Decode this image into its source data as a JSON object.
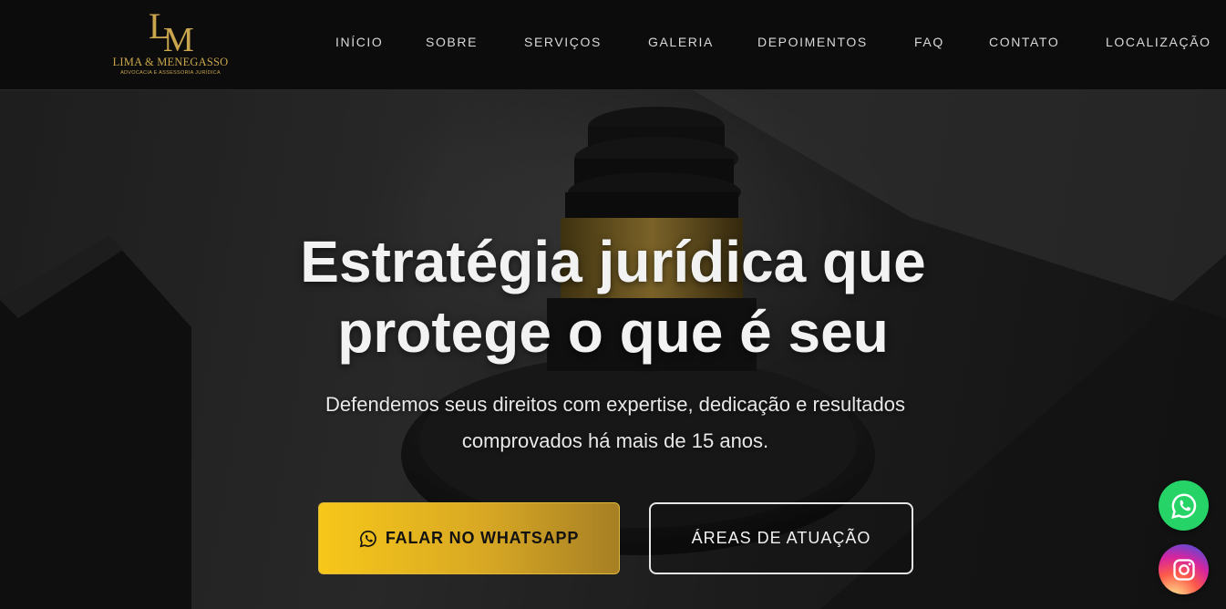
{
  "brand": {
    "monogram": "LM",
    "name": "LIMA & MENEGASSO",
    "tagline": "ADVOCACIA E ASSESSORIA JURÍDICA",
    "gold": "#c9a64e"
  },
  "nav": {
    "items": [
      {
        "label": "INÍCIO"
      },
      {
        "label": "SOBRE"
      },
      {
        "label": "SERVIÇOS"
      },
      {
        "label": "GALERIA"
      },
      {
        "label": "DEPOIMENTOS"
      },
      {
        "label": "FAQ"
      },
      {
        "label": "CONTATO"
      },
      {
        "label": "LOCALIZAÇÃO"
      }
    ]
  },
  "hero": {
    "headline_line1": "Estratégia jurídica que",
    "headline_line2": "protege o que é seu",
    "subtitle_line1": "Defendemos seus direitos com expertise, dedicação e resultados",
    "subtitle_line2": "comprovados há mais de 15 anos.",
    "cta_primary": {
      "label": "FALAR NO WHATSAPP",
      "icon": "whatsapp-icon"
    },
    "cta_secondary": {
      "label": "ÁREAS DE ATUAÇÃO"
    },
    "background_image": "judge-gavel"
  },
  "floating": {
    "whatsapp": {
      "icon": "whatsapp-icon",
      "color": "#25d366"
    },
    "instagram": {
      "icon": "instagram-icon"
    }
  },
  "colors": {
    "accent_yellow": "#f7c71a",
    "header_bg": "#0c0c0c"
  }
}
